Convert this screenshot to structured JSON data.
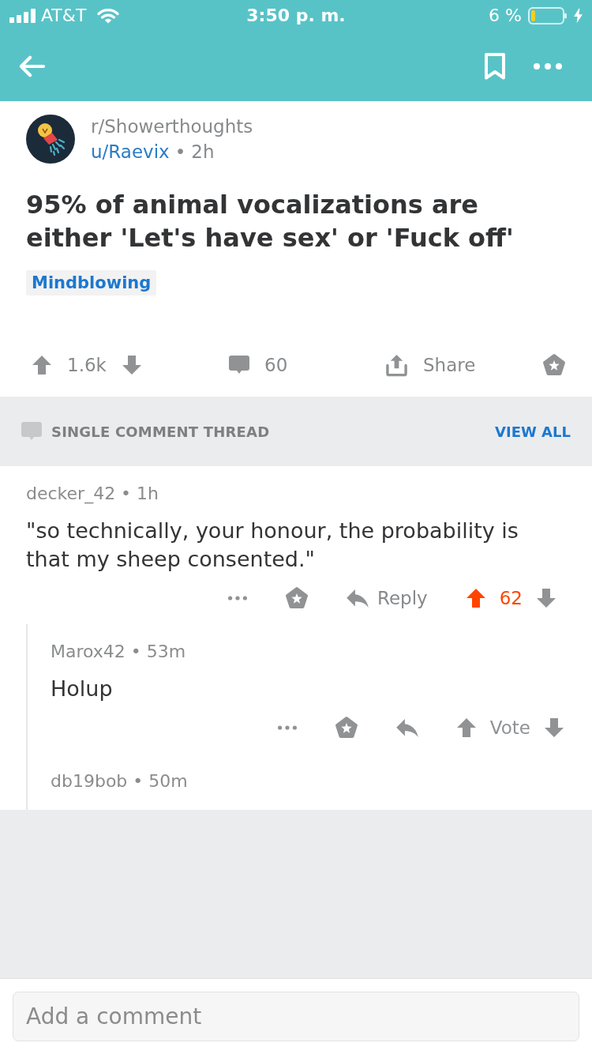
{
  "status_bar": {
    "carrier": "AT&T",
    "time": "3:50 p. m.",
    "battery": "6 %"
  },
  "post": {
    "subreddit": "r/Showerthoughts",
    "author": "u/Raevix",
    "separator": "•",
    "age": "2h",
    "title": "95% of animal vocalizations are either 'Let's have sex' or 'Fuck off'",
    "flair": "Mindblowing",
    "upvoted": false,
    "score": "1.6k",
    "comments": "60",
    "share": "Share"
  },
  "thread_bar": {
    "label": "SINGLE COMMENT THREAD",
    "link": "VIEW ALL"
  },
  "comments": [
    {
      "byline": "decker_42 • 1h",
      "body": "\"so technically, your honour, the probability is that my sheep consented.\"",
      "reply": "Reply",
      "upvoted": true,
      "score": "62",
      "children": [
        {
          "byline": "Marox42 • 53m",
          "body": "Holup",
          "upvoted": false,
          "score": "Vote"
        },
        {
          "byline": "db19bob • 50m"
        }
      ]
    }
  ],
  "composer": {
    "placeholder": "Add a comment"
  }
}
